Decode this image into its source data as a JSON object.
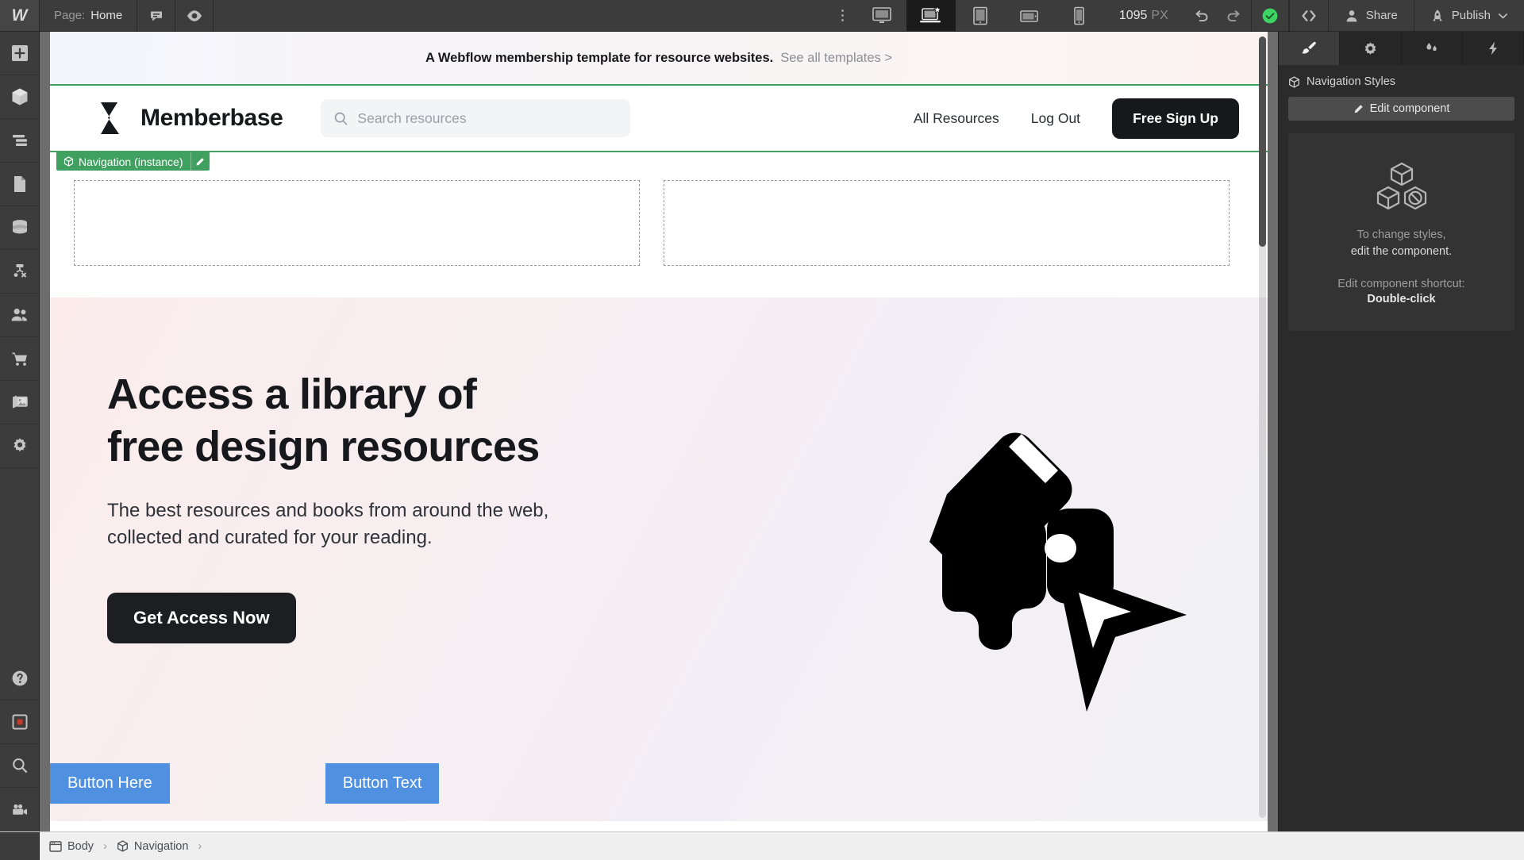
{
  "topbar": {
    "logo": "W",
    "page_label": "Page:",
    "page_value": "Home",
    "comment_icon": "comment-icon",
    "preview_icon": "eye-preview-icon",
    "more_icon": "more-options-icon",
    "breakpoints": [
      {
        "name": "desktop-large",
        "icon": "monitor-icon",
        "active": false
      },
      {
        "name": "desktop-base",
        "icon": "laptop-star-icon",
        "active": true
      },
      {
        "name": "tablet",
        "icon": "tablet-icon",
        "active": false
      },
      {
        "name": "mobile-landscape",
        "icon": "mobile-landscape-icon",
        "active": false
      },
      {
        "name": "mobile-portrait",
        "icon": "mobile-portrait-icon",
        "active": false
      }
    ],
    "canvas_width": "1095",
    "canvas_unit": "PX",
    "undo_icon": "undo-icon",
    "redo_icon": "redo-icon",
    "status_icon": "saved-check-icon",
    "code_icon": "code-brackets-icon",
    "share_label": "Share",
    "share_icon": "person-icon",
    "publish_label": "Publish",
    "publish_icon": "rocket-icon",
    "publish_chevron": "chevron-down-icon"
  },
  "rail": {
    "items": [
      {
        "name": "add-elements",
        "icon": "plus-icon"
      },
      {
        "name": "components",
        "icon": "cube-icon"
      },
      {
        "name": "navigator",
        "icon": "layers-icon"
      },
      {
        "name": "pages",
        "icon": "page-icon"
      },
      {
        "name": "cms",
        "icon": "database-icon"
      },
      {
        "name": "logic",
        "icon": "flow-icon"
      },
      {
        "name": "users",
        "icon": "users-icon"
      },
      {
        "name": "ecommerce",
        "icon": "cart-icon"
      },
      {
        "name": "assets",
        "icon": "images-icon"
      },
      {
        "name": "settings",
        "icon": "gear-icon"
      }
    ],
    "bottom_items": [
      {
        "name": "help",
        "icon": "question-circle-icon"
      },
      {
        "name": "record-video",
        "icon": "record-square-icon"
      },
      {
        "name": "search",
        "icon": "magnifier-icon"
      },
      {
        "name": "video-tutorials",
        "icon": "video-camera-icon"
      }
    ]
  },
  "canvas": {
    "selection_badge": {
      "label": "Navigation (instance)",
      "cube_icon": "component-cube-icon",
      "edit_icon": "pencil-icon"
    },
    "site_banner": {
      "message": "A Webflow membership template for resource websites.",
      "link": "See all templates >"
    },
    "nav": {
      "brand": "Memberbase",
      "logo_icon": "memberbase-logo-icon",
      "search_placeholder": "Search resources",
      "search_icon": "search-icon",
      "links": [
        "All Resources",
        "Log Out"
      ],
      "cta": "Free Sign Up"
    },
    "placeholders": [
      {
        "name": "empty-div-block-left"
      },
      {
        "name": "empty-div-block-right"
      }
    ],
    "hero": {
      "heading": "Access a library of\nfree design resources",
      "subheading": "The best resources and books from around the web,\ncollected and curated for your reading.",
      "cta": "Get Access Now",
      "art_icon": "pen-and-cursor-illustration",
      "button_left": "Button Here",
      "button_right": "Button Text",
      "button_color": "#4f90e0"
    }
  },
  "right_panel": {
    "tabs": [
      {
        "name": "style",
        "icon": "paintbrush-icon",
        "active": true
      },
      {
        "name": "settings",
        "icon": "gear-icon",
        "active": false
      },
      {
        "name": "interactions",
        "icon": "droplets-icon",
        "active": false
      },
      {
        "name": "effects",
        "icon": "lightning-icon",
        "active": false
      }
    ],
    "title": "Navigation Styles",
    "title_icon": "component-cube-icon",
    "edit_component": "Edit component",
    "edit_icon": "pencil-icon",
    "notice_icon": "locked-component-icon",
    "notice_line1": "To change styles,",
    "notice_line2": "edit the component.",
    "notice_line3": "Edit component shortcut:",
    "notice_line4": "Double-click"
  },
  "bottom_bar": {
    "crumbs": [
      {
        "label": "Body",
        "icon": "body-window-icon"
      },
      {
        "label": "Navigation",
        "icon": "component-cube-icon"
      }
    ],
    "separator": "›"
  },
  "colors": {
    "selection_green": "#3fa060",
    "accent_blue": "#4f90e0",
    "chrome_dark": "#3c3c3c",
    "panel_dark": "#2b2b2b"
  }
}
